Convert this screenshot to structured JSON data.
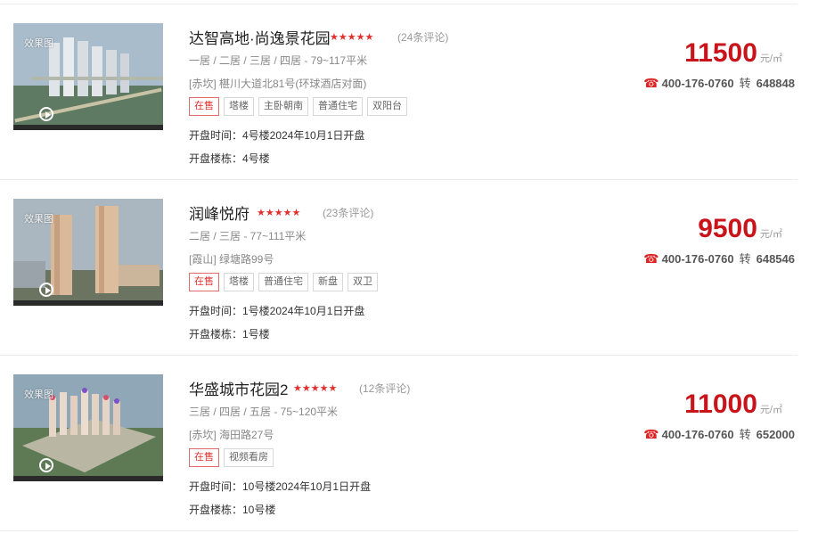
{
  "listings": [
    {
      "thumb_tag": "效果图",
      "name": "达智高地·尚逸景花园",
      "stars": "★★★★★",
      "comments": "(24条评论)",
      "rooms": "一居 / 二居 / 三居 / 四居   - 79~117平米",
      "address": "[赤坎]  椹川大道北81号(环球酒店对面)",
      "tags": [
        "在售",
        "塔楼",
        "主卧朝南",
        "普通住宅",
        "双阳台"
      ],
      "open_time": "开盘时间：4号楼2024年10月1日开盘",
      "open_building": "开盘楼栋：4号楼",
      "price": "11500",
      "price_unit": "元/㎡",
      "phone": "400-176-0760",
      "zhuan": "转",
      "ext": "648848"
    },
    {
      "thumb_tag": "效果图",
      "name": "润峰悦府",
      "stars": "★★★★★",
      "comments": "(23条评论)",
      "rooms": "二居 / 三居   - 77~111平米",
      "address": "[霞山]  绿塘路99号",
      "tags": [
        "在售",
        "塔楼",
        "普通住宅",
        "新盘",
        "双卫"
      ],
      "open_time": "开盘时间：1号楼2024年10月1日开盘",
      "open_building": "开盘楼栋：1号楼",
      "price": "9500",
      "price_unit": "元/㎡",
      "phone": "400-176-0760",
      "zhuan": "转",
      "ext": "648546"
    },
    {
      "thumb_tag": "效果图",
      "name": "华盛城市花园2",
      "stars": "★★★★★",
      "comments": "(12条评论)",
      "rooms": "三居 / 四居 / 五居   - 75~120平米",
      "address": "[赤坎]  海田路27号",
      "tags": [
        "在售",
        "视频看房"
      ],
      "open_time": "开盘时间：10号楼2024年10月1日开盘",
      "open_building": "开盘楼栋：10号楼",
      "price": "11000",
      "price_unit": "元/㎡",
      "phone": "400-176-0760",
      "zhuan": "转",
      "ext": "652000"
    }
  ],
  "icons": {
    "phone": "phone-icon",
    "play": "play-icon"
  },
  "colors": {
    "price": "#c8141a",
    "stars": "#e03130",
    "on_sale": "#e03130"
  }
}
